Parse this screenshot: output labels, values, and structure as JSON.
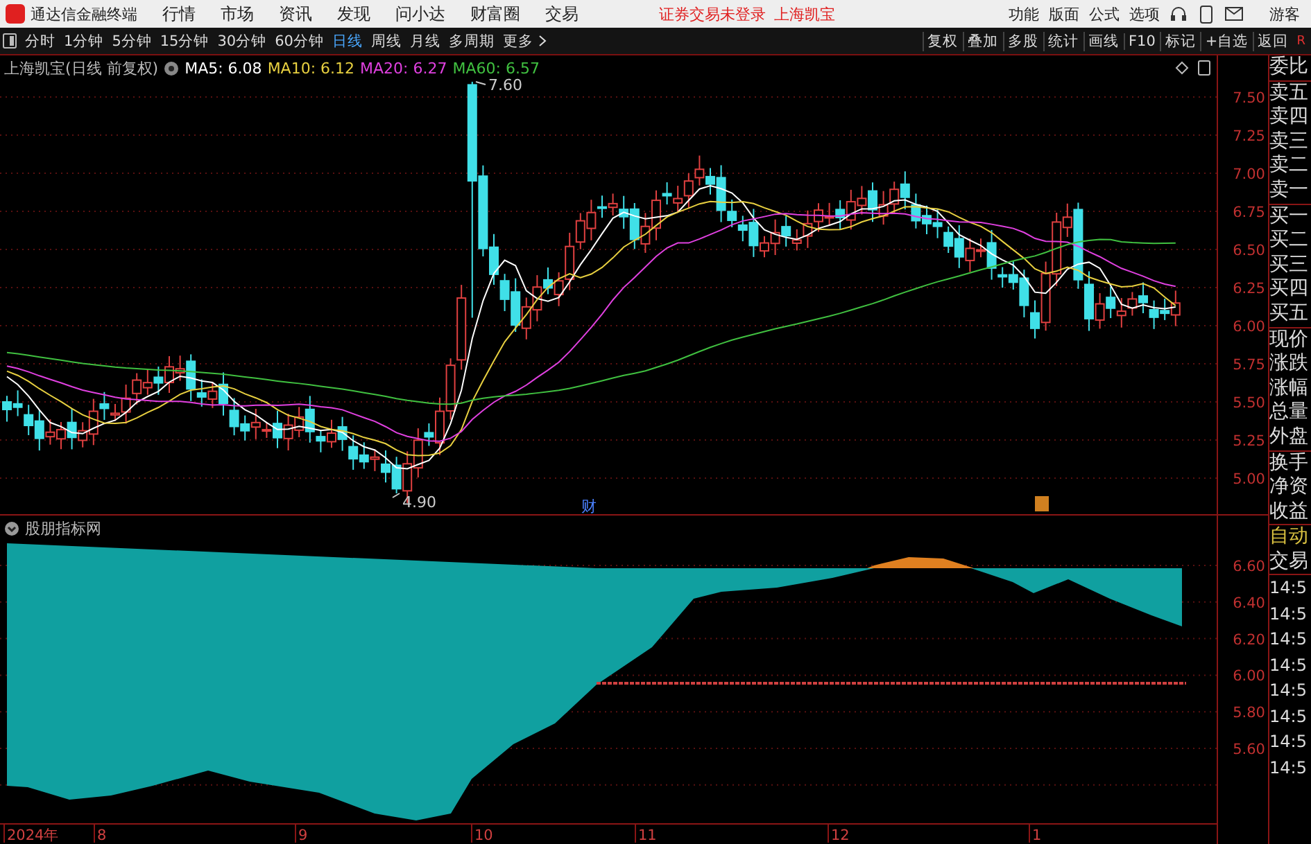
{
  "app_bar": {
    "title": "通达信金融终端",
    "menus": [
      "行情",
      "市场",
      "资讯",
      "发现",
      "问小达",
      "财富圈",
      "交易"
    ],
    "login_status": "证券交易未登录",
    "stock_name": "上海凯宝",
    "tools": [
      "功能",
      "版面",
      "公式",
      "选项"
    ],
    "user": "游客"
  },
  "period_bar": {
    "periods": [
      {
        "label": "分时",
        "selected": false
      },
      {
        "label": "1分钟",
        "selected": false
      },
      {
        "label": "5分钟",
        "selected": false
      },
      {
        "label": "15分钟",
        "selected": false
      },
      {
        "label": "30分钟",
        "selected": false
      },
      {
        "label": "60分钟",
        "selected": false
      },
      {
        "label": "日线",
        "selected": true
      },
      {
        "label": "周线",
        "selected": false
      },
      {
        "label": "月线",
        "selected": false
      },
      {
        "label": "多周期",
        "selected": false
      }
    ],
    "more": "更多",
    "actions": [
      "复权",
      "叠加",
      "多股",
      "统计",
      "画线",
      "F10",
      "标记",
      "+自选",
      "返回"
    ],
    "corner": "R"
  },
  "price_chart": {
    "title": "上海凯宝(日线 前复权)",
    "averages": [
      {
        "label": "MA5: 6.08",
        "color": "#ffffff"
      },
      {
        "label": "MA10: 6.12",
        "color": "#e8d040"
      },
      {
        "label": "MA20: 6.27",
        "color": "#e040e0"
      },
      {
        "label": "MA60: 6.57",
        "color": "#40c040"
      }
    ],
    "high_label": "7.60",
    "low_label": "4.90",
    "event_label": "财",
    "y_axis": [
      "7.50",
      "7.25",
      "7.00",
      "6.75",
      "6.50",
      "6.25",
      "6.00",
      "5.75",
      "5.50",
      "5.25",
      "5.00"
    ]
  },
  "indicator": {
    "title": "股朋指标网",
    "y_axis": [
      "6.60",
      "6.40",
      "6.20",
      "6.00",
      "5.80",
      "5.60"
    ]
  },
  "date_axis": [
    "2024年",
    "8",
    "9",
    "10",
    "11",
    "12",
    "1"
  ],
  "quote_panel": {
    "groups": [
      [
        "委比"
      ],
      [
        "卖五",
        "卖四",
        "卖三",
        "卖二",
        "卖一"
      ],
      [
        "买一",
        "买二",
        "买三",
        "买四",
        "买五"
      ],
      [
        "现价",
        "涨跌",
        "涨幅",
        "总量",
        "外盘"
      ],
      [
        "换手",
        "净资",
        "收益"
      ]
    ],
    "mode": "自动",
    "trade": "交易",
    "times": [
      "14:5",
      "14:5",
      "14:5",
      "14:5",
      "14:5",
      "14:5",
      "14:5",
      "14:5"
    ]
  }
}
